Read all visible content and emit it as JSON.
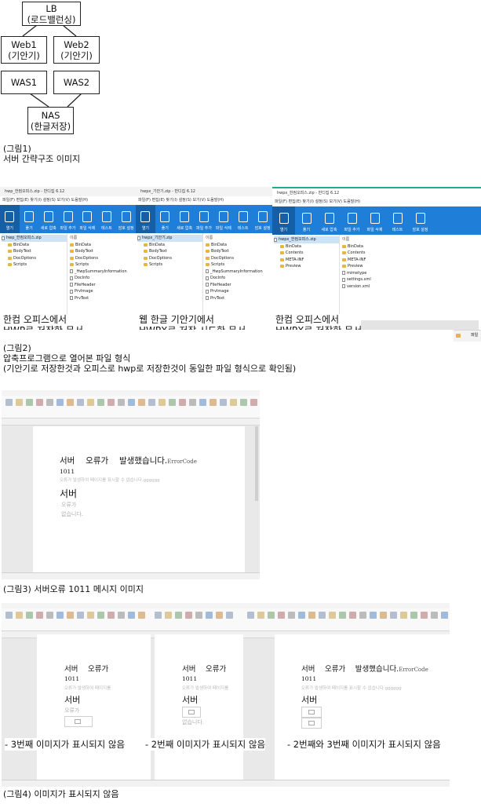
{
  "diagram": {
    "nodes": {
      "lb": [
        "LB",
        "(로드밸런싱)"
      ],
      "web1": [
        "Web1",
        "(기안기)"
      ],
      "web2": [
        "Web2",
        "(기안기)"
      ],
      "was1": [
        "WAS1"
      ],
      "was2": [
        "WAS2"
      ],
      "nas": [
        "NAS",
        "(한글저장)"
      ]
    }
  },
  "captions": {
    "fig1_line1": "(그림1)",
    "fig1_line2": "서버 간략구조 이미지",
    "fig2_line1": "(그림2)",
    "fig2_line2": "압축프로그램으로 열어본 파일 형식",
    "fig2_line3": "(기안기로 저장한것과 오피스로 hwp로 저장한것이 동일한 파일 형식으로 확인됨)",
    "fig3": "(그림3) 서버오류 1011 메시지 이미지",
    "fig4": "(그림4) 이미지가 표시되지 않음"
  },
  "bandizip": {
    "toolbar_labels": [
      "열기",
      "풀기",
      "새로 압축",
      "파일 추가",
      "파일 삭제",
      "테스트",
      "암호 설정"
    ],
    "menu": "파일(F)  편집(E)  찾기(I)  설정(S)  보기(V)  도움말(H)",
    "windows": [
      {
        "title": "hwp_한컴오피스.zip - 반디집 6.12",
        "root": "hwp_한컴오피스.zip",
        "tree": [
          "BinData",
          "BodyText",
          "DocOptions",
          "Scripts"
        ],
        "files_header": "이름",
        "files": [
          "BinData",
          "BodyText",
          "DocOptions",
          "Scripts",
          "_HwpSummaryInformation",
          "DocInfo",
          "FileHeader",
          "PrvImage",
          "PrvText"
        ],
        "caption": [
          "한컴 오피스에서",
          "HWP로 저장한 문서"
        ]
      },
      {
        "title": "hwpx_기안기.zip - 반디집 6.12",
        "root": "hwpx_기안기.zip",
        "tree": [
          "BinData",
          "BodyText",
          "DocOptions",
          "Scripts"
        ],
        "files_header": "이름",
        "files": [
          "BinData",
          "BodyText",
          "DocOptions",
          "Scripts",
          "_HwpSummaryInformation",
          "DocInfo",
          "FileHeader",
          "PrvImage",
          "PrvText"
        ],
        "caption": [
          "웹 한글 기안기에서",
          "HWPX로 저장 시도한 문서"
        ]
      },
      {
        "title": "hwpx_한컴오피스.zip - 반디집 6.12",
        "root": "hwpx_한컴오피스.zip",
        "tree": [
          "BinData",
          "Contents",
          "META-INF",
          "Preview"
        ],
        "files_header": "이름",
        "files": [
          "BinData",
          "Contents",
          "META-INF",
          "Preview",
          "mimetype",
          "settings.xml",
          "version.xml"
        ],
        "caption": [
          "한컴 오피스에서",
          "HWPX로 저장한 문서"
        ]
      }
    ],
    "side_label": "파일"
  },
  "error_doc": {
    "title": "서버 　오류가 　발생했습니다.",
    "code_label": "ErrorCode",
    "code": "1011",
    "sub": "오류가 발생하여 페이지를 표시할 수 없습니다.gggggg",
    "server": "서버",
    "gray1": "오류가",
    "gray2": "없습니다."
  },
  "fig4": {
    "panel1": {
      "title": "서버 　오류가",
      "code": "1011",
      "sub": "오류가 발생하여 페이지를",
      "server": "서버",
      "gray": "오류가"
    },
    "panel2": {
      "title": "서버 　오류가",
      "code": "1011",
      "sub": "오류가 발생하여 페이지를",
      "server": "서버",
      "gray": "없습니다."
    },
    "panel3": {
      "title": "서버 　오류가 　발생했습니다.",
      "code_label": "ErrorCode",
      "code": "1011",
      "sub": "오류가 발생하여 페이지를 표시할 수 없습니다.gggggg",
      "server": "서버"
    },
    "notes": [
      "- 3번째 이미지가 표시되지 않음",
      "- 2번째 이미지가 표시되지 않음",
      "- 2번째와 3번째 이미지가 표시되지 않음"
    ]
  },
  "colors": {
    "toolbar_blue": "#1f7ed8",
    "active_tab_green": "#18b08f",
    "folder_yellow": "#e8b640"
  }
}
